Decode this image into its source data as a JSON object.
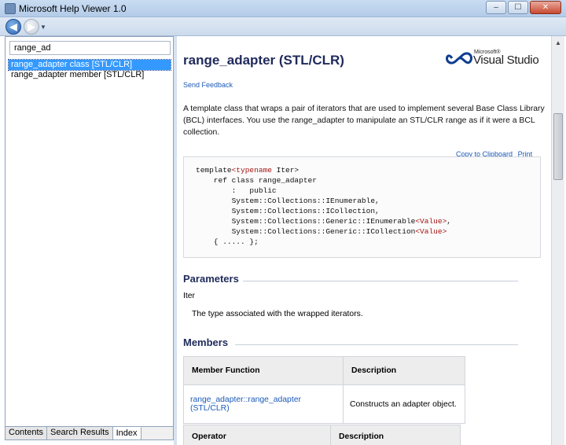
{
  "window": {
    "title": "Microsoft Help Viewer 1.0",
    "buttons": {
      "minimize": "‒",
      "maximize": "☐",
      "close": "✕"
    }
  },
  "toolbar": {
    "back_glyph": "◀",
    "forward_glyph": "▶",
    "dropdown_glyph": "▼"
  },
  "left_pane": {
    "search_value": "range_ad",
    "index_items": [
      {
        "label": "range_adapter class [STL/CLR]",
        "selected": true
      },
      {
        "label": "range_adapter member [STL/CLR]",
        "selected": false
      }
    ],
    "tabs": [
      {
        "label": "Contents",
        "active": false
      },
      {
        "label": "Search Results",
        "active": false
      },
      {
        "label": "Index",
        "active": true
      }
    ]
  },
  "content": {
    "title": "range_adapter (STL/CLR)",
    "logo": {
      "microsoft": "Microsoft®",
      "product": "Visual Studio"
    },
    "send_feedback": "Send Feedback",
    "intro": "A template class that wraps a pair of iterators that are used to implement several Base Class Library (BCL) interfaces. You use the range_adapter to manipulate an STL/CLR range as if it were a BCL collection.",
    "copy_to_clipboard": "Copy to Clipboard",
    "print": "Print",
    "code": {
      "line1_a": "template",
      "line1_b": "<typename",
      "line1_c": " Iter>",
      "line2": "    ref class range_adapter",
      "line3": "        :   public",
      "line4": "        System::Collections::IEnumerable,",
      "line5": "        System::Collections::ICollection,",
      "line6_a": "        System::Collections::Generic::IEnumerable",
      "line6_b": "<Value>",
      "line6_c": ",",
      "line7_a": "        System::Collections::Generic::ICollection",
      "line7_b": "<Value>",
      "line8": "    { ..... };"
    },
    "parameters_heading": "Parameters",
    "param_name": "Iter",
    "param_desc": "The type associated with the wrapped iterators.",
    "members_heading": "Members",
    "members_table": {
      "headers": [
        "Member Function",
        "Description"
      ],
      "rows": [
        {
          "name": "range_adapter::range_adapter (STL/CLR)",
          "desc": "Constructs an adapter object."
        }
      ]
    },
    "operators_table": {
      "headers": [
        "Operator",
        "Description"
      ]
    }
  },
  "colors": {
    "title": "#1f2a5b",
    "link": "#1b5ab8",
    "selection": "#3399ff"
  }
}
